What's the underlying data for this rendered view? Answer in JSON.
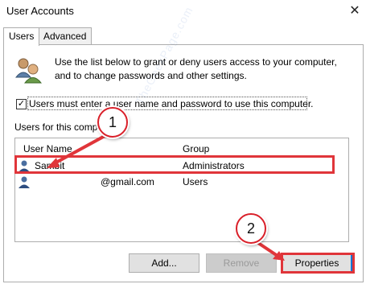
{
  "window": {
    "title": "User Accounts",
    "close_glyph": "✕"
  },
  "tabs": [
    {
      "label": "Users",
      "active": true
    },
    {
      "label": "Advanced",
      "active": false
    }
  ],
  "intro_text": "Use the list below to grant or deny users access to your computer, and to change passwords and other settings.",
  "checkbox": {
    "label": "Users must enter a user name and password to use this computer.",
    "checked": true,
    "check_glyph": "✓"
  },
  "users_section_label": "Users for this computer:",
  "columns": [
    "User Name",
    "Group"
  ],
  "rows": [
    {
      "user_name": "Sambit",
      "group": "Administrators",
      "icon": "user-icon"
    },
    {
      "user_name": "@gmail.com",
      "group": "Users",
      "icon": "user-icon"
    }
  ],
  "buttons": {
    "add": "Add...",
    "remove": "Remove",
    "properties": "Properties"
  },
  "annotations": {
    "marker_1": "1",
    "marker_2": "2",
    "highlight_color": "#e0353a"
  },
  "watermark": "TheGeekPage.com"
}
